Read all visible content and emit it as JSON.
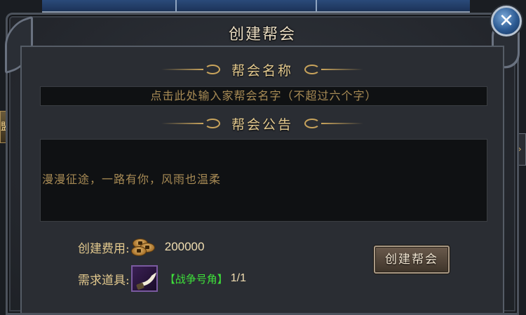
{
  "dialog": {
    "title": "创建帮会"
  },
  "sections": {
    "name_header": "帮会名称",
    "notice_header": "帮会公告"
  },
  "name_input": {
    "placeholder": "点击此处输入家帮会名字（不超过六个字）"
  },
  "notice": {
    "text": "漫漫征途，一路有你，风雨也温柔"
  },
  "cost": {
    "label": "创建费用:",
    "icon": "coin-icon",
    "value": "200000"
  },
  "required_item": {
    "label": "需求道具:",
    "icon": "horn-icon",
    "name": "【战争号角】",
    "count": "1/1"
  },
  "buttons": {
    "create": "创建帮会",
    "close": "✕"
  },
  "background": {
    "left_button": "盟"
  },
  "colors": {
    "gold_text": "#e3c98e",
    "item_green": "#3ee03a",
    "close_blue": "#2c5a92"
  }
}
